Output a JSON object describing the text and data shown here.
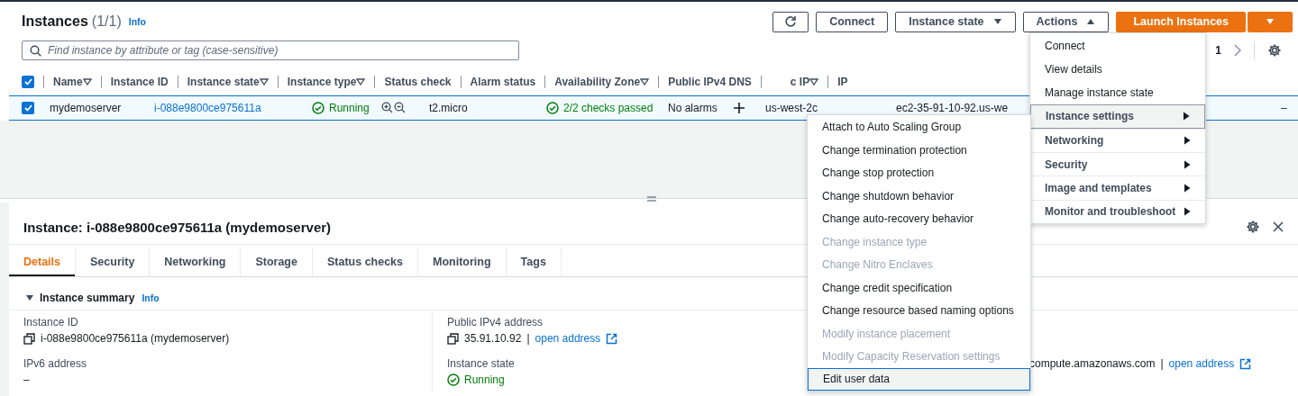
{
  "header": {
    "title": "Instances",
    "count": "(1/1)",
    "info": "Info"
  },
  "toolbar": [
    {
      "kind": "refresh"
    },
    {
      "kind": "plain",
      "label": "Connect"
    },
    {
      "kind": "dropdown",
      "label": "Instance state",
      "expanded": false
    },
    {
      "kind": "dropdown",
      "label": "Actions",
      "expanded": true
    },
    {
      "kind": "primary",
      "label": "Launch Instances"
    },
    {
      "kind": "primary-caret"
    }
  ],
  "search": {
    "placeholder": "Find instance by attribute or tag (case-sensitive)"
  },
  "pagination": {
    "page": "1"
  },
  "table": {
    "all_selected": true,
    "columns": [
      {
        "label": "Name",
        "filter": true
      },
      {
        "label": "Instance ID",
        "filter": false
      },
      {
        "label": "Instance state",
        "filter": true
      },
      {
        "label": "Instance type",
        "filter": true
      },
      {
        "label": "Status check",
        "filter": false
      },
      {
        "label": "Alarm status",
        "filter": false
      },
      {
        "label": "Availability Zone",
        "filter": true
      },
      {
        "label": "Public IPv4 DNS",
        "filter": false
      },
      {
        "label": "c IP",
        "filter": true
      },
      {
        "label": "IP",
        "filter": false
      }
    ],
    "rows": [
      {
        "selected": true,
        "name": "mydemoserver",
        "instance_id": "i-088e9800ce975611a",
        "state": "Running",
        "type": "t2.micro",
        "status_check": "2/2 checks passed",
        "alarm": "No alarms",
        "zone": "us-west-2c",
        "dns": "ec2-35-91-10-92.us-we",
        "column_10": "",
        "column_11": "–"
      }
    ]
  },
  "details": {
    "title": "Instance: i-088e9800ce975611a (mydemoserver)",
    "tabs": [
      {
        "label": "Details",
        "selected": true
      },
      {
        "label": "Security",
        "selected": false
      },
      {
        "label": "Networking",
        "selected": false
      },
      {
        "label": "Storage",
        "selected": false
      },
      {
        "label": "Status checks",
        "selected": false
      },
      {
        "label": "Monitoring",
        "selected": false
      },
      {
        "label": "Tags",
        "selected": false
      }
    ],
    "section": {
      "title": "Instance summary",
      "info": "Info",
      "expanded": true
    },
    "columns": [
      [
        {
          "kind": "copy",
          "label": "Instance ID",
          "value": "i-088e9800ce975611a (mydemoserver)"
        },
        {
          "kind": "plain",
          "label": "IPv6 address",
          "value": "–"
        }
      ],
      [
        {
          "kind": "copy",
          "label": "Public IPv4 address",
          "value": "35.91.10.92",
          "separator": "|",
          "link": "open address"
        },
        {
          "kind": "status",
          "label": "Instance state",
          "value": "Running"
        }
      ],
      [
        {
          "kind": "plain",
          "value": "compute.amazonaws.com",
          "separator": "|",
          "link": "open address"
        }
      ]
    ]
  },
  "actions_menu": [
    {
      "kind": "item",
      "label": "Connect",
      "selected": false
    },
    {
      "kind": "item",
      "label": "View details",
      "selected": false
    },
    {
      "kind": "item",
      "label": "Manage instance state",
      "selected": false
    },
    {
      "kind": "submenu",
      "label": "Instance settings",
      "selected": true
    },
    {
      "kind": "submenu",
      "label": "Networking",
      "selected": false
    },
    {
      "kind": "submenu",
      "label": "Security",
      "selected": false
    },
    {
      "kind": "submenu",
      "label": "Image and templates",
      "selected": false
    },
    {
      "kind": "submenu",
      "label": "Monitor and troubleshoot",
      "selected": false
    }
  ],
  "submenu": [
    {
      "label": "Attach to Auto Scaling Group",
      "disabled": false,
      "selected": false
    },
    {
      "label": "Change termination protection",
      "disabled": false,
      "selected": false
    },
    {
      "label": "Change stop protection",
      "disabled": false,
      "selected": false
    },
    {
      "label": "Change shutdown behavior",
      "disabled": false,
      "selected": false
    },
    {
      "label": "Change auto-recovery behavior",
      "disabled": false,
      "selected": false
    },
    {
      "label": "Change instance type",
      "disabled": true,
      "selected": false
    },
    {
      "label": "Change Nitro Enclaves",
      "disabled": true,
      "selected": false
    },
    {
      "label": "Change credit specification",
      "disabled": false,
      "selected": false
    },
    {
      "label": "Change resource based naming options",
      "disabled": false,
      "selected": false
    },
    {
      "label": "Modify instance placement",
      "disabled": true,
      "selected": false
    },
    {
      "label": "Modify Capacity Reservation settings",
      "disabled": true,
      "selected": false
    },
    {
      "label": "Edit user data",
      "disabled": false,
      "selected": true
    }
  ]
}
